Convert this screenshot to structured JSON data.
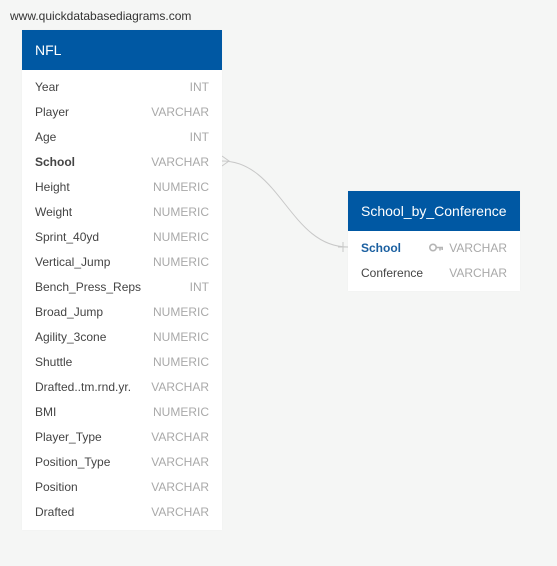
{
  "watermark": "www.quickdatabasediagrams.com",
  "colors": {
    "header": "#0058a3",
    "pk_text": "#1a5fa0",
    "connector": "#c8c8c8"
  },
  "tables": {
    "nfl": {
      "title": "NFL",
      "columns": [
        {
          "name": "Year",
          "type": "INT"
        },
        {
          "name": "Player",
          "type": "VARCHAR"
        },
        {
          "name": "Age",
          "type": "INT"
        },
        {
          "name": "School",
          "type": "VARCHAR"
        },
        {
          "name": "Height",
          "type": "NUMERIC"
        },
        {
          "name": "Weight",
          "type": "NUMERIC"
        },
        {
          "name": "Sprint_40yd",
          "type": "NUMERIC"
        },
        {
          "name": "Vertical_Jump",
          "type": "NUMERIC"
        },
        {
          "name": "Bench_Press_Reps",
          "type": "INT"
        },
        {
          "name": "Broad_Jump",
          "type": "NUMERIC"
        },
        {
          "name": "Agility_3cone",
          "type": "NUMERIC"
        },
        {
          "name": "Shuttle",
          "type": "NUMERIC"
        },
        {
          "name": "Drafted..tm.rnd.yr.",
          "type": "VARCHAR"
        },
        {
          "name": "BMI",
          "type": "NUMERIC"
        },
        {
          "name": "Player_Type",
          "type": "VARCHAR"
        },
        {
          "name": "Position_Type",
          "type": "VARCHAR"
        },
        {
          "name": "Position",
          "type": "VARCHAR"
        },
        {
          "name": "Drafted",
          "type": "VARCHAR"
        }
      ]
    },
    "school_by_conference": {
      "title": "School_by_Conference",
      "columns": [
        {
          "name": "School",
          "type": "VARCHAR",
          "icon": "key-icon"
        },
        {
          "name": "Conference",
          "type": "VARCHAR"
        }
      ]
    }
  }
}
